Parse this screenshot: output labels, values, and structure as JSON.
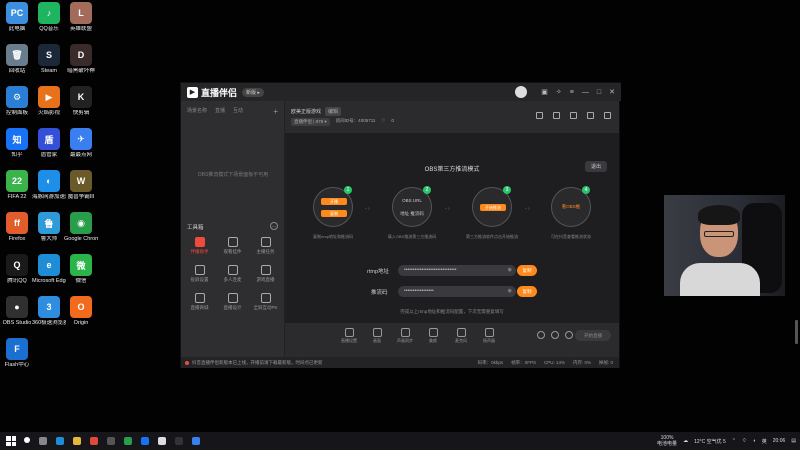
{
  "desktop": {
    "icons": [
      {
        "label": "此电脑",
        "color": "#3b8ee0",
        "glyph": "PC"
      },
      {
        "label": "QQ音乐",
        "color": "#1fb45f",
        "glyph": "♪"
      },
      {
        "label": "英雄联盟",
        "color": "#a26b5a",
        "glyph": "L"
      },
      {
        "label": "回收站",
        "color": "#6a7d8f",
        "glyph": "🗑"
      },
      {
        "label": "Steam",
        "color": "#1b2838",
        "glyph": "S"
      },
      {
        "label": "暗黑破坏神",
        "color": "#3a2a2a",
        "glyph": "D"
      },
      {
        "label": "控制面板",
        "color": "#2a7fd4",
        "glyph": "⚙"
      },
      {
        "label": "火焰影视",
        "color": "#e8711c",
        "glyph": "▶"
      },
      {
        "label": "快剪辑",
        "color": "#222",
        "glyph": "K"
      },
      {
        "label": "知乎",
        "color": "#1772f6",
        "glyph": "知"
      },
      {
        "label": "盾管家",
        "color": "#3550d8",
        "glyph": "盾"
      },
      {
        "label": "最最点网",
        "color": "#3a7ff0",
        "glyph": "✈"
      },
      {
        "label": "FIFA 22",
        "color": "#3ab44a",
        "glyph": "22"
      },
      {
        "label": "海豚网游加速器5.0",
        "color": "#1e8fe8",
        "glyph": "◐"
      },
      {
        "label": "魔兽争霸III",
        "color": "#6a5a2a",
        "glyph": "W"
      },
      {
        "label": "Firefox",
        "color": "#e25d2c",
        "glyph": "ff"
      },
      {
        "label": "鲁大师",
        "color": "#2f9ad8",
        "glyph": "鲁"
      },
      {
        "label": "Google Chrome",
        "color": "#2a9d4a",
        "glyph": "◉"
      },
      {
        "label": "腾讯QQ",
        "color": "#1a1a1a",
        "glyph": "Q"
      },
      {
        "label": "Microsoft Edge",
        "color": "#1f8dd6",
        "glyph": "e"
      },
      {
        "label": "微信",
        "color": "#2ab44a",
        "glyph": "微"
      },
      {
        "label": "OBS Studio",
        "color": "#303030",
        "glyph": "●"
      },
      {
        "label": "360极速浏览器",
        "color": "#2f8de0",
        "glyph": "3"
      },
      {
        "label": "Origin",
        "color": "#f26b1d",
        "glyph": "O"
      },
      {
        "label": "Flash中心",
        "color": "#1a6fd0",
        "glyph": "F"
      }
    ]
  },
  "window": {
    "logo_text": "直播伴侣",
    "version": "新版 ▸",
    "left_tabs": [
      "场景名称",
      "直播",
      "互动"
    ],
    "add_label": "+",
    "empty_text": "OBS推流模式下场景面板不可用",
    "toolbox_title": "工具箱",
    "tools": [
      {
        "label": "伴播助手",
        "active": true
      },
      {
        "label": "观看挂件",
        "active": false
      },
      {
        "label": "主播任务",
        "active": false
      },
      {
        "label": "投屏设置",
        "active": false
      },
      {
        "label": "多人连麦",
        "active": false
      },
      {
        "label": "游戏直播",
        "active": false
      },
      {
        "label": "直播商城",
        "active": false
      },
      {
        "label": "直播设计",
        "active": false
      },
      {
        "label": "全屏互动PK",
        "active": false
      }
    ],
    "room": {
      "title": "欧美正版游戏",
      "edit": "编辑",
      "category": "直播伴侣 | 878 ▾",
      "id_label": "房间ID号：4005711",
      "likes": "0"
    },
    "stage": {
      "mode_title": "OBS第三方推流模式",
      "exit": "退出",
      "steps": [
        {
          "num": "1",
          "pill1": "开播",
          "pill2": "复制",
          "caption": "复制rtmp地址和推流码"
        },
        {
          "num": "2",
          "line1": "OBS URL",
          "line2": "地址 推流码",
          "caption": "填入OBS推流第三方推流码"
        },
        {
          "num": "3",
          "pill1": "开始推流",
          "caption": "第三方推流软件点击开始推流"
        },
        {
          "num": "4",
          "line1": "看OBS推",
          "caption": "可在抖音查看推流状态"
        }
      ],
      "rtmp_label": "rtmp地址",
      "rtmp_value": "••••••••••••••••••••••••••••••",
      "key_label": "推流码",
      "key_value": "•••••••••••••••••",
      "copy": "复制",
      "hint": "完成以上rtmp地址和推流码配置，下次无需重复填写"
    },
    "bottom_tools": [
      "直播设置",
      "画面",
      "声画同步",
      "美颜",
      "麦克风",
      "扬声器"
    ],
    "start_btn": "开始直播",
    "status": {
      "notice": "抖音直播伴侣新版本已上线，开播前请下载最新版，时间点已更新",
      "stats": [
        "码率：0kbps",
        "帧率：0FPS",
        "CPU: 14%",
        "内存: 0%",
        "掉帧: 0"
      ]
    }
  },
  "taskbar": {
    "battery": "100%",
    "battery_sub": "电池电量",
    "weather": "12°C 空气优 5",
    "time": "20:06"
  }
}
